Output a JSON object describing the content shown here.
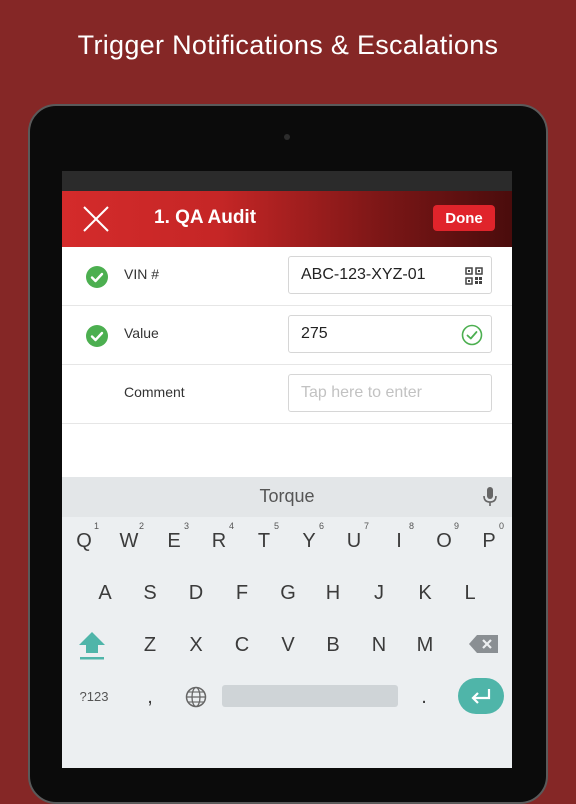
{
  "headline": "Trigger Notifications & Escalations",
  "app": {
    "title": "1. QA Audit",
    "done_label": "Done"
  },
  "form": {
    "rows": [
      {
        "label": "VIN #",
        "value": "ABC-123-XYZ-01",
        "checked": true,
        "icon": "qr-code-icon"
      },
      {
        "label": "Value",
        "value": "275",
        "checked": true,
        "icon": "valid-check-icon"
      },
      {
        "label": "Comment",
        "placeholder": "Tap here to enter",
        "checked": false
      }
    ]
  },
  "keyboard": {
    "suggestion": "Torque",
    "row1": [
      "Q",
      "W",
      "E",
      "R",
      "T",
      "Y",
      "U",
      "I",
      "O",
      "P"
    ],
    "row1_hints": [
      "1",
      "2",
      "3",
      "4",
      "5",
      "6",
      "7",
      "8",
      "9",
      "0"
    ],
    "row2": [
      "A",
      "S",
      "D",
      "F",
      "G",
      "H",
      "J",
      "K",
      "L"
    ],
    "row3": [
      "Z",
      "X",
      "C",
      "V",
      "B",
      "N",
      "M"
    ],
    "symbols_label": "?123",
    "comma_label": ",",
    "period_label": "."
  },
  "colors": {
    "background": "#852726",
    "accent_red": "#e0242b",
    "check_green": "#4caf50",
    "keyboard_accent": "#4fb5a9"
  }
}
